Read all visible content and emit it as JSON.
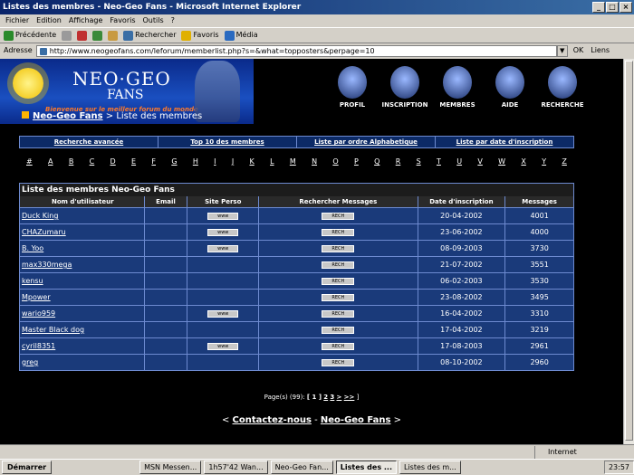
{
  "window": {
    "title": "Listes des membres - Neo-Geo Fans - Microsoft Internet Explorer"
  },
  "menu": [
    "Fichier",
    "Edition",
    "Affichage",
    "Favoris",
    "Outils",
    "?"
  ],
  "toolbar": {
    "back": "Précédente",
    "search": "Rechercher",
    "favorites": "Favoris",
    "media": "Média"
  },
  "address": {
    "label": "Adresse",
    "url": "http://www.neogeofans.com/leforum/memberlist.php?s=&what=topposters&perpage=10",
    "go": "OK",
    "links": "Liens"
  },
  "header": {
    "logo_line1": "NEO·GEO",
    "logo_line2": "FANS",
    "tagline": "Bienvenue sur le meilleur forum du monde",
    "nav": [
      "PROFIL",
      "INSCRIPTION",
      "MEMBRES",
      "AIDE",
      "RECHERCHE"
    ],
    "breadcrumb_link": "Neo-Geo Fans",
    "breadcrumb_current": "> Liste des membres"
  },
  "filters": [
    "Recherche avancée",
    "Top 10 des membres",
    "Liste par ordre Alphabetique",
    "Liste par date d'inscription"
  ],
  "letters": [
    "#",
    "A",
    "B",
    "C",
    "D",
    "E",
    "F",
    "G",
    "H",
    "I",
    "J",
    "K",
    "L",
    "M",
    "N",
    "O",
    "P",
    "Q",
    "R",
    "S",
    "T",
    "U",
    "V",
    "W",
    "X",
    "Y",
    "Z"
  ],
  "table": {
    "caption": "Liste des membres Neo-Geo Fans",
    "headers": [
      "Nom d'utilisateur",
      "Email",
      "Site Perso",
      "Rechercher Messages",
      "Date d'inscription",
      "Messages"
    ],
    "www_label": "www",
    "rech_label": "RECH",
    "rows": [
      {
        "name": "Duck King",
        "site": true,
        "date": "20-04-2002",
        "messages": "4001"
      },
      {
        "name": "CHAZumaru",
        "site": true,
        "date": "23-06-2002",
        "messages": "4000"
      },
      {
        "name": "B. Yoo",
        "site": true,
        "date": "08-09-2003",
        "messages": "3730"
      },
      {
        "name": "max330mega",
        "site": false,
        "date": "21-07-2002",
        "messages": "3551"
      },
      {
        "name": "kensu",
        "site": false,
        "date": "06-02-2003",
        "messages": "3530"
      },
      {
        "name": "Mpower",
        "site": false,
        "date": "23-08-2002",
        "messages": "3495"
      },
      {
        "name": "wario959",
        "site": true,
        "date": "16-04-2002",
        "messages": "3310"
      },
      {
        "name": "Master Black dog",
        "site": false,
        "date": "17-04-2002",
        "messages": "3219"
      },
      {
        "name": "cyril8351",
        "site": true,
        "date": "17-08-2003",
        "messages": "2961"
      },
      {
        "name": "greg",
        "site": false,
        "date": "08-10-2002",
        "messages": "2960"
      }
    ]
  },
  "pager": {
    "label": "Page(s) (99):",
    "current": "[ 1 ]",
    "links": [
      "2",
      "3",
      ">",
      ">>"
    ],
    "end": "]"
  },
  "footer": {
    "left": "<",
    "contact": "Contactez-nous",
    "sep": "-",
    "site": "Neo-Geo Fans",
    "right": ">"
  },
  "status": {
    "zone": "Internet"
  },
  "taskbar": {
    "start": "Démarrer",
    "tasks": [
      "MSN Messen...",
      "1h57'42 Wan...",
      "Neo-Geo Fan...",
      "Listes des ...",
      "Listes des m..."
    ],
    "clock": "23:57"
  }
}
